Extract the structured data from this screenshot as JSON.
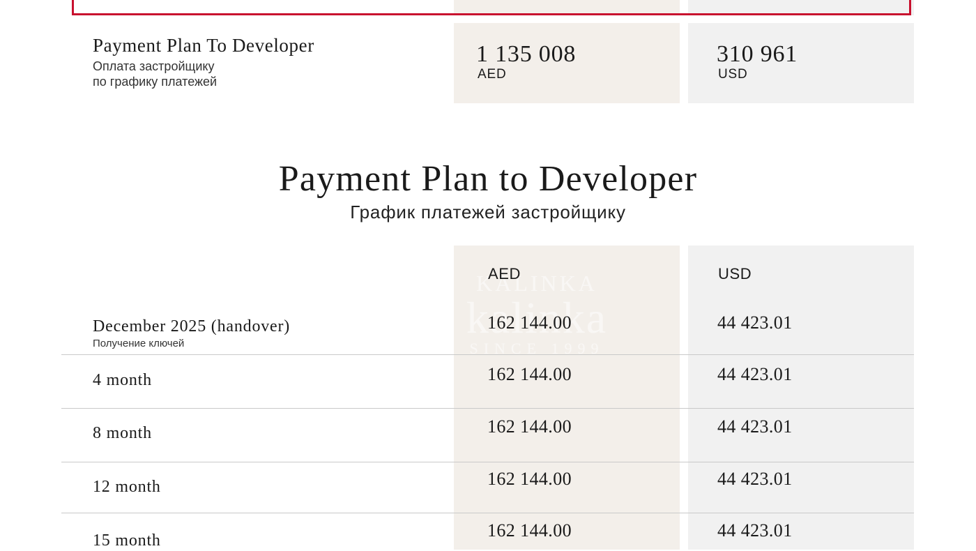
{
  "summary": {
    "title": "Payment Plan To Developer",
    "subtitle_line1": "Оплата застройщику",
    "subtitle_line2": "по графику платежей",
    "aed": {
      "amount": "1 135 008",
      "currency": "AED"
    },
    "usd": {
      "amount": "310 961",
      "currency": "USD"
    }
  },
  "heading": {
    "title": "Payment Plan to Developer",
    "subtitle": "График платежей застройщику"
  },
  "table": {
    "columns": {
      "aed": "AED",
      "usd": "USD"
    },
    "rows": [
      {
        "label": "December 2025 (handover)",
        "sublabel": "Получение ключей",
        "aed": "162 144.00",
        "usd": "44 423.01"
      },
      {
        "label": "4 month",
        "aed": "162 144.00",
        "usd": "44 423.01"
      },
      {
        "label": "8 month",
        "aed": "162 144.00",
        "usd": "44 423.01"
      },
      {
        "label": "12 month",
        "aed": "162 144.00",
        "usd": "44 423.01"
      },
      {
        "label": "15 month",
        "aed": "162 144.00",
        "usd": "44 423.01"
      }
    ]
  },
  "watermark": {
    "brand_top": "KALINKA",
    "brand_big": "kalinka",
    "since": "SINCE 1999"
  },
  "colors": {
    "accent_red": "#c8102e",
    "aed_column": "#f3efea",
    "usd_column": "#f1f1f1"
  }
}
